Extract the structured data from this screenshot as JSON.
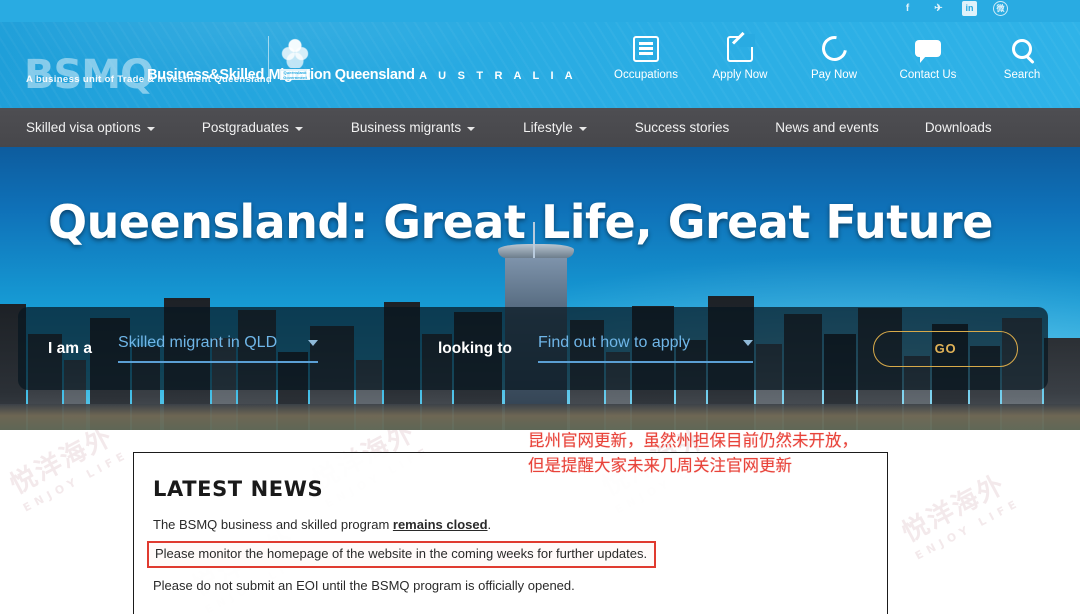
{
  "social": {
    "icons": [
      {
        "name": "facebook-icon",
        "glyph": "f"
      },
      {
        "name": "twitter-icon",
        "glyph": "✈"
      },
      {
        "name": "linkedin-icon",
        "glyph": "in"
      },
      {
        "name": "weibo-icon",
        "glyph": "微"
      }
    ]
  },
  "header": {
    "logo": {
      "mark": "BSMQ",
      "line1": "Business&Skilled",
      "line2": "Migration Queensland",
      "line3": "A U S T R A L I A",
      "tagline": "A business unit of Trade & Investment Queensland",
      "crest_label": "Queensland Government"
    },
    "quick_links": [
      {
        "label": "Occupations",
        "icon": "list-box-icon"
      },
      {
        "label": "Apply Now",
        "icon": "pencil-box-icon"
      },
      {
        "label": "Pay Now",
        "icon": "coin-icon"
      },
      {
        "label": "Contact Us",
        "icon": "chat-bubble-icon"
      },
      {
        "label": "Search",
        "icon": "search-icon"
      }
    ]
  },
  "nav": {
    "items": [
      {
        "label": "Skilled visa options",
        "has_caret": true
      },
      {
        "label": "Postgraduates",
        "has_caret": true
      },
      {
        "label": "Business migrants",
        "has_caret": true
      },
      {
        "label": "Lifestyle",
        "has_caret": true
      },
      {
        "label": "Success stories",
        "has_caret": false
      },
      {
        "label": "News and events",
        "has_caret": false
      },
      {
        "label": "Downloads",
        "has_caret": false
      }
    ]
  },
  "hero": {
    "title": "Queensland: Great Life, Great Future",
    "search": {
      "label_prefix": "I am a",
      "select_one_value": "Skilled migrant in QLD",
      "label_middle": "looking to",
      "select_two_value": "Find out how to apply",
      "go_label": "GO"
    }
  },
  "news": {
    "title": "LATEST NEWS",
    "line1_prefix": "The BSMQ business and skilled program ",
    "line1_bold": "remains closed",
    "line1_suffix": ".",
    "line2_highlighted": "Please monitor the homepage of the website in the coming weeks for further updates.",
    "line3": "Please do not submit an EOI until the BSMQ program is officially opened."
  },
  "annotation": {
    "line1": "昆州官网更新，虽然州担保目前仍然未开放，",
    "line2": "但是提醒大家未来几周关注官网更新",
    "color": "#e8433a"
  },
  "watermark": {
    "cn": "悦洋海外",
    "en": "ENJOY LIFE"
  },
  "colors": {
    "header_blue": "#29abe2",
    "nav_gray": "#47474b",
    "accent_gold": "#d8aa4a",
    "link_blue": "#6fb6e8",
    "alert_red": "#e03a2f"
  }
}
